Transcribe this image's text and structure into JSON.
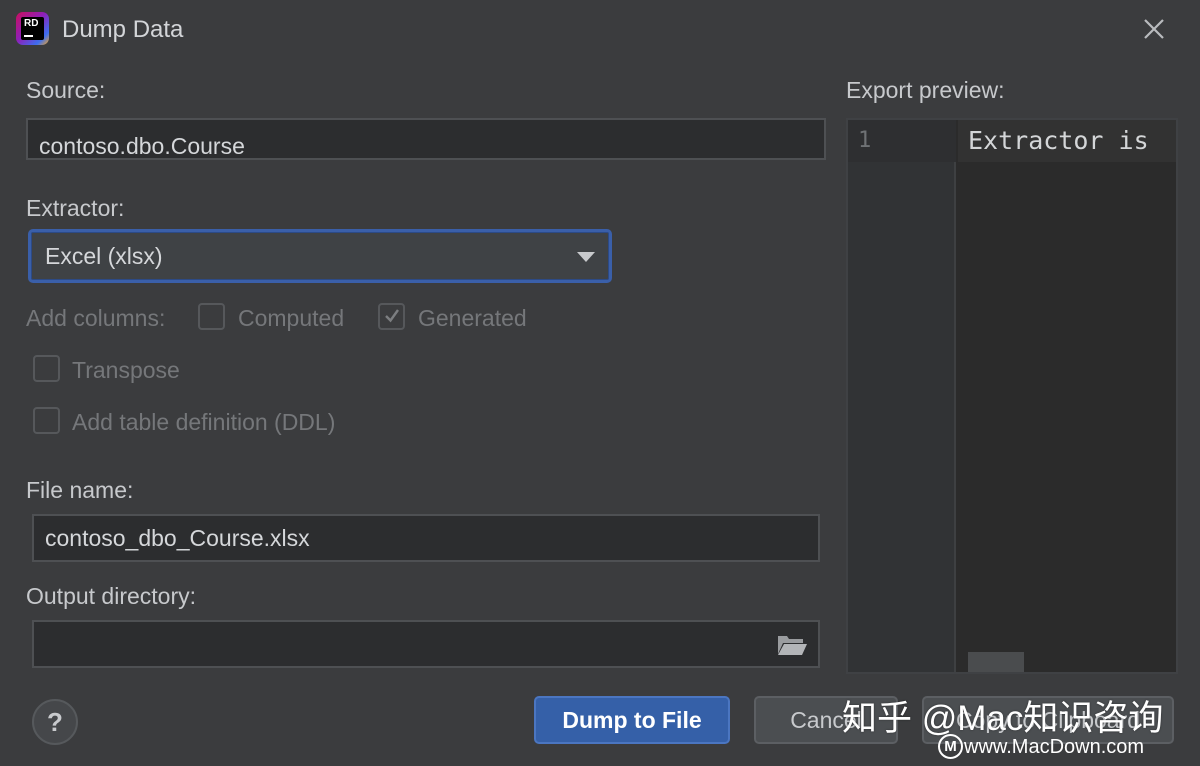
{
  "window": {
    "title": "Dump Data",
    "app_logo_text": "RD"
  },
  "source": {
    "label": "Source:",
    "value": "contoso.dbo.Course"
  },
  "extractor": {
    "label": "Extractor:",
    "selected": "Excel (xlsx)"
  },
  "add_columns": {
    "label": "Add columns:",
    "computed_label": "Computed",
    "computed_checked": false,
    "generated_label": "Generated",
    "generated_checked": true
  },
  "options": {
    "transpose_label": "Transpose",
    "transpose_checked": false,
    "ddl_label": "Add table definition (DDL)",
    "ddl_checked": false
  },
  "file_name": {
    "label": "File name:",
    "value": "contoso_dbo_Course.xlsx"
  },
  "output_directory": {
    "label": "Output directory:",
    "value": ""
  },
  "preview": {
    "label": "Export preview:",
    "line_number": "1",
    "code": "Extractor is"
  },
  "buttons": {
    "help": "?",
    "dump": "Dump to File",
    "cancel": "Cancel",
    "copy": "Copy to Clipboard"
  },
  "watermark": {
    "main": "知乎 @Mac知识咨询",
    "sub": "www.MacDown.com",
    "logo": "M"
  },
  "colors": {
    "background": "#3b3c3e",
    "primary_button": "#3560a8",
    "focus_border": "#3a5fa9"
  },
  "icons": {
    "close": "close-icon",
    "dropdown": "chevron-down-icon",
    "folder": "folder-open-icon",
    "check": "checkmark-icon"
  }
}
